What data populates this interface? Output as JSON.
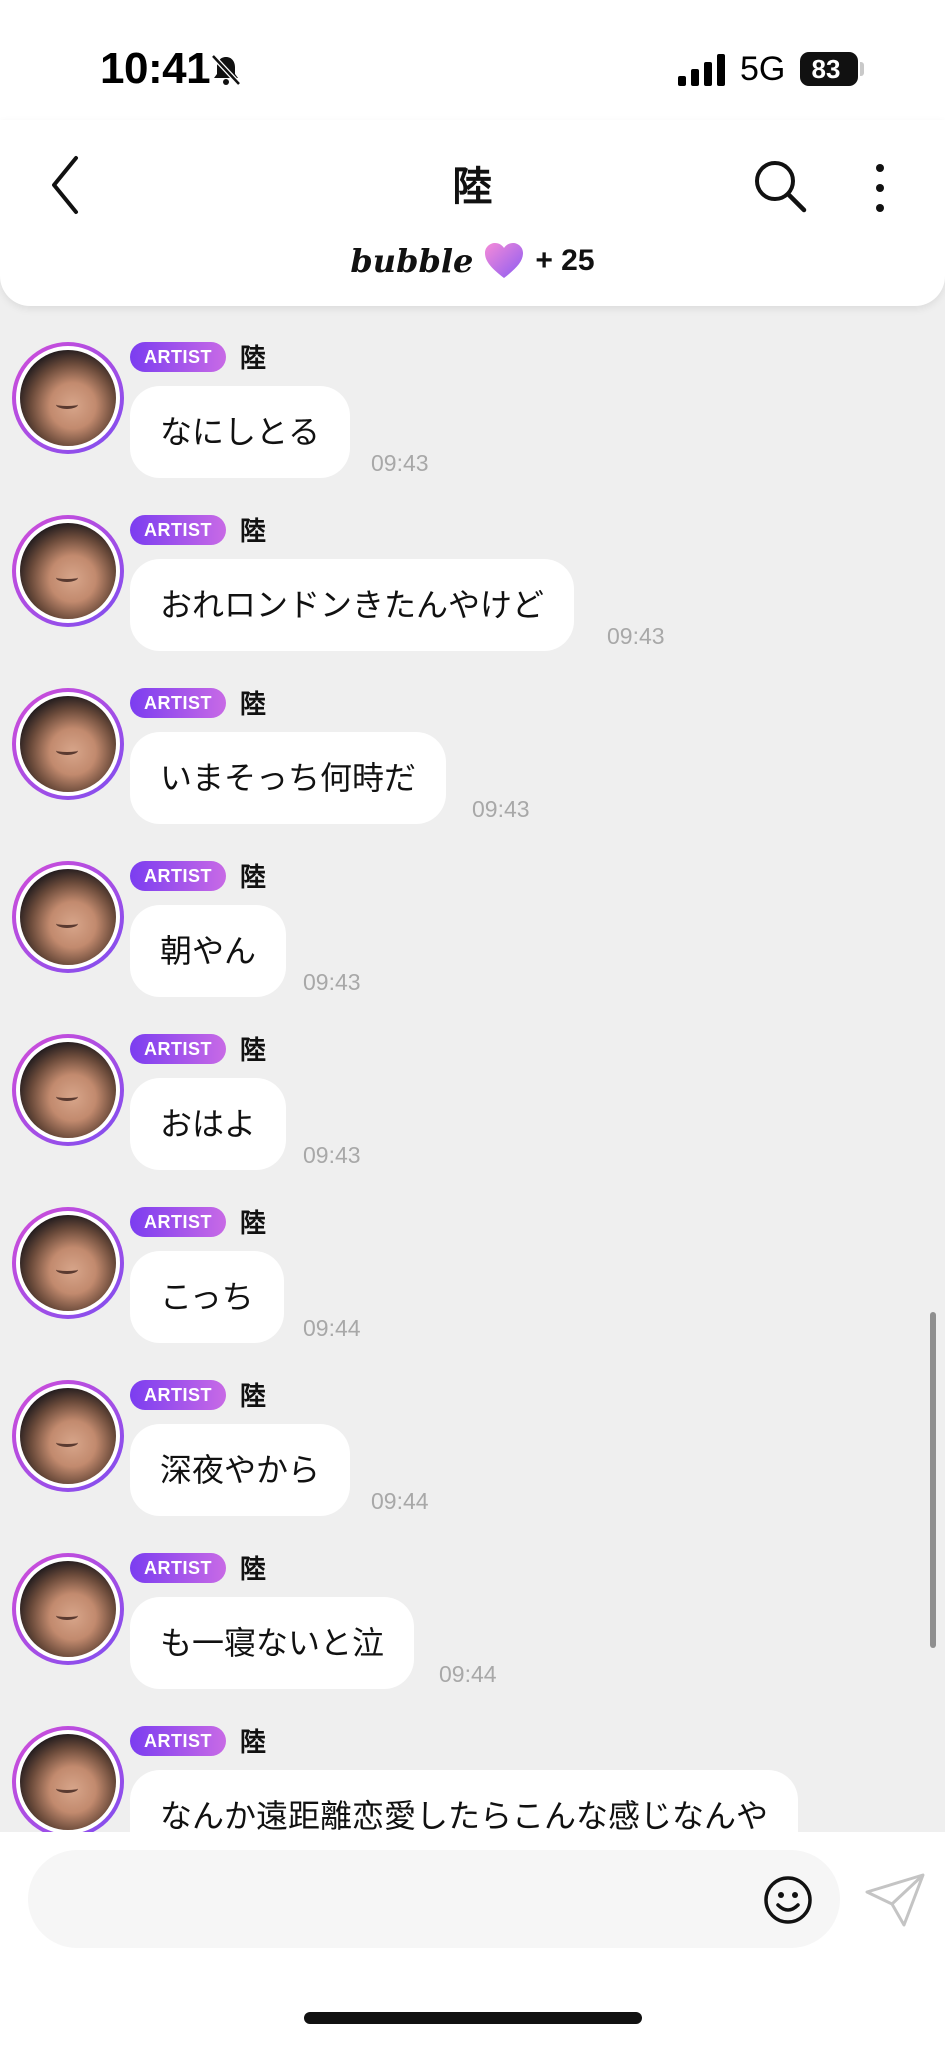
{
  "status_bar": {
    "time": "10:41",
    "network": "5G",
    "battery": "83"
  },
  "header": {
    "title": "陸",
    "bubble_brand": "bubble",
    "bubble_count": "+ 25"
  },
  "messages": [
    {
      "badge": "ARTIST",
      "sender": "陸",
      "text": "なにしとる",
      "time": "09:43"
    },
    {
      "badge": "ARTIST",
      "sender": "陸",
      "text": "おれロンドンきたんやけど",
      "time": "09:43"
    },
    {
      "badge": "ARTIST",
      "sender": "陸",
      "text": "いまそっち何時だ",
      "time": "09:43"
    },
    {
      "badge": "ARTIST",
      "sender": "陸",
      "text": "朝やん",
      "time": "09:43"
    },
    {
      "badge": "ARTIST",
      "sender": "陸",
      "text": "おはよ",
      "time": "09:43"
    },
    {
      "badge": "ARTIST",
      "sender": "陸",
      "text": "こっち",
      "time": "09:44"
    },
    {
      "badge": "ARTIST",
      "sender": "陸",
      "text": "深夜やから",
      "time": "09:44"
    },
    {
      "badge": "ARTIST",
      "sender": "陸",
      "text": "も一寝ないと泣",
      "time": "09:44"
    },
    {
      "badge": "ARTIST",
      "sender": "陸",
      "text": "なんか遠距離恋愛したらこんな感じなんや",
      "time": ""
    }
  ],
  "input": {
    "value": "",
    "placeholder": ""
  },
  "colors": {
    "accent_start": "#7b3df0",
    "accent_end": "#c86ae6",
    "chat_background": "#efefef",
    "bubble_background": "#ffffff",
    "timestamp": "#a8a8a8"
  },
  "icons": {
    "back": "chevron-left-icon",
    "search": "search-icon",
    "more": "more-vertical-icon",
    "bubble_heart": "heart-icon",
    "emoji": "smiley-icon",
    "send": "paper-plane-icon"
  }
}
